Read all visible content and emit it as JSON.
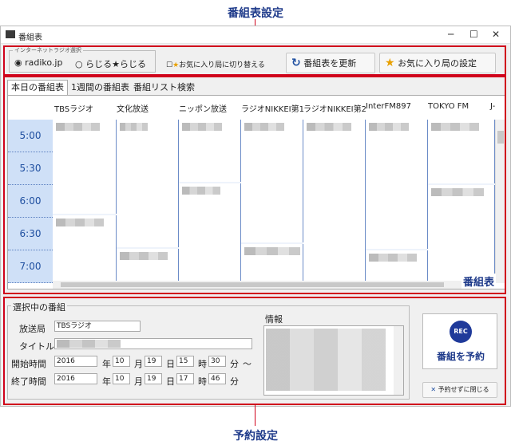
{
  "callouts": {
    "top": "番組表設定",
    "middle": "番組表",
    "bottom": "予約設定"
  },
  "window": {
    "title": "番組表",
    "minimize": "─",
    "maximize": "☐",
    "close": "✕"
  },
  "source": {
    "group_label": "インターネットラジオ選択",
    "radiko": "radiko.jp",
    "radiru": "らじる★らじる"
  },
  "toolbar": {
    "fav_toggle": "お気に入り局に切り替える",
    "refresh": "番組表を更新",
    "fav_settings": "お気に入り局の設定"
  },
  "tabs": [
    "本日の番組表",
    "1週間の番組表",
    "番組リスト検索"
  ],
  "stations": [
    "TBSラジオ",
    "文化放送",
    "ニッポン放送",
    "ラジオNIKKEI第1",
    "ラジオNIKKEI第2",
    "InterFM897",
    "TOKYO FM",
    "J-"
  ],
  "times": [
    "5:00",
    "5:30",
    "6:00",
    "6:30",
    "7:00"
  ],
  "selected": {
    "group_label": "選択中の番組",
    "station_label": "放送局",
    "station": "TBSラジオ",
    "title_label": "タイトル",
    "start_label": "開始時間",
    "end_label": "終了時間",
    "year_suffix": "年",
    "month_suffix": "月",
    "day_suffix": "日",
    "hour_suffix": "時",
    "minute_suffix": "分",
    "tilde": "～",
    "start": {
      "year": "2016",
      "month": "10",
      "day": "19",
      "hour": "15",
      "minute": "30"
    },
    "end": {
      "year": "2016",
      "month": "10",
      "day": "19",
      "hour": "17",
      "minute": "46"
    },
    "info_label": "情報"
  },
  "reserve": {
    "rec_badge": "REC",
    "reserve_label": "番組を予約",
    "close_label": "予約せずに閉じる"
  }
}
